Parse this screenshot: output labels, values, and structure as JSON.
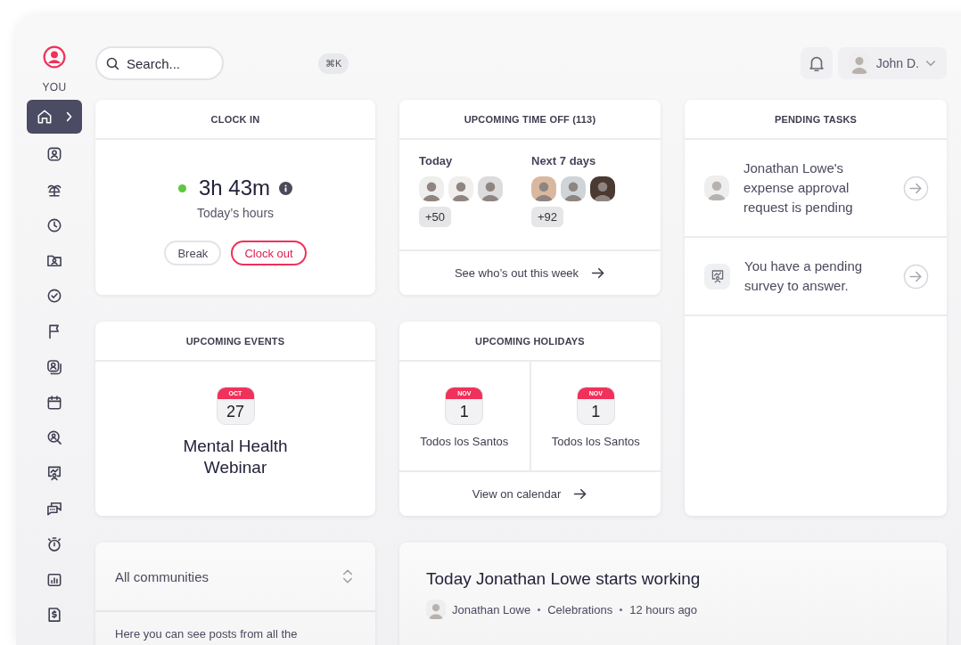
{
  "sidebar": {
    "profile_label": "YOU",
    "items": [
      {
        "selected": true
      },
      {
        "selected": false
      },
      {
        "selected": false
      },
      {
        "selected": false
      },
      {
        "selected": false
      },
      {
        "selected": false
      },
      {
        "selected": false
      },
      {
        "selected": false
      },
      {
        "selected": false
      },
      {
        "selected": false
      },
      {
        "selected": false
      },
      {
        "selected": false
      },
      {
        "selected": false
      },
      {
        "selected": false
      },
      {
        "selected": false
      }
    ]
  },
  "topbar": {
    "search": {
      "placeholder": "Search..."
    },
    "shortcut": "⌘K",
    "user": "John D."
  },
  "clock_in": {
    "title": "CLOCK IN",
    "clocked_in": true,
    "hours": "3h 43m",
    "hours_label": "Today’s hours",
    "buttons": [
      {
        "label": "Break",
        "kind": "secondary"
      },
      {
        "label": "Clock out",
        "kind": "primary"
      }
    ]
  },
  "time_off": {
    "title": "UPCOMING TIME OFF (113)",
    "groups": [
      {
        "label": "Today",
        "more": "+50"
      },
      {
        "label": "Next 7 days",
        "more": "+92"
      }
    ],
    "link": "See who’s out this week"
  },
  "pending_tasks": {
    "title": "PENDING TASKS",
    "tasks": [
      {
        "kind": "person",
        "text": "Jonathan Lowe's expense approval request is pending"
      },
      {
        "kind": "survey",
        "text": "You have a pending survey to answer."
      }
    ]
  },
  "events": {
    "title": "UPCOMING EVENTS",
    "items": [
      {
        "month": "OCT",
        "day": "27",
        "name": "Mental Health Webinar"
      }
    ]
  },
  "holidays": {
    "title": "UPCOMING HOLIDAYS",
    "items": [
      {
        "month": "NOV",
        "day": "1",
        "name": "Todos los Santos"
      },
      {
        "month": "NOV",
        "day": "1",
        "name": "Todos los Santos"
      }
    ],
    "link": "View on calendar"
  },
  "communities": {
    "selector": "All communities",
    "description": "Here you can see posts from all the"
  },
  "post": {
    "title": "Today Jonathan Lowe starts working",
    "meta": [
      "Jonathan Lowe",
      "Celebrations",
      "12 hours ago"
    ]
  }
}
